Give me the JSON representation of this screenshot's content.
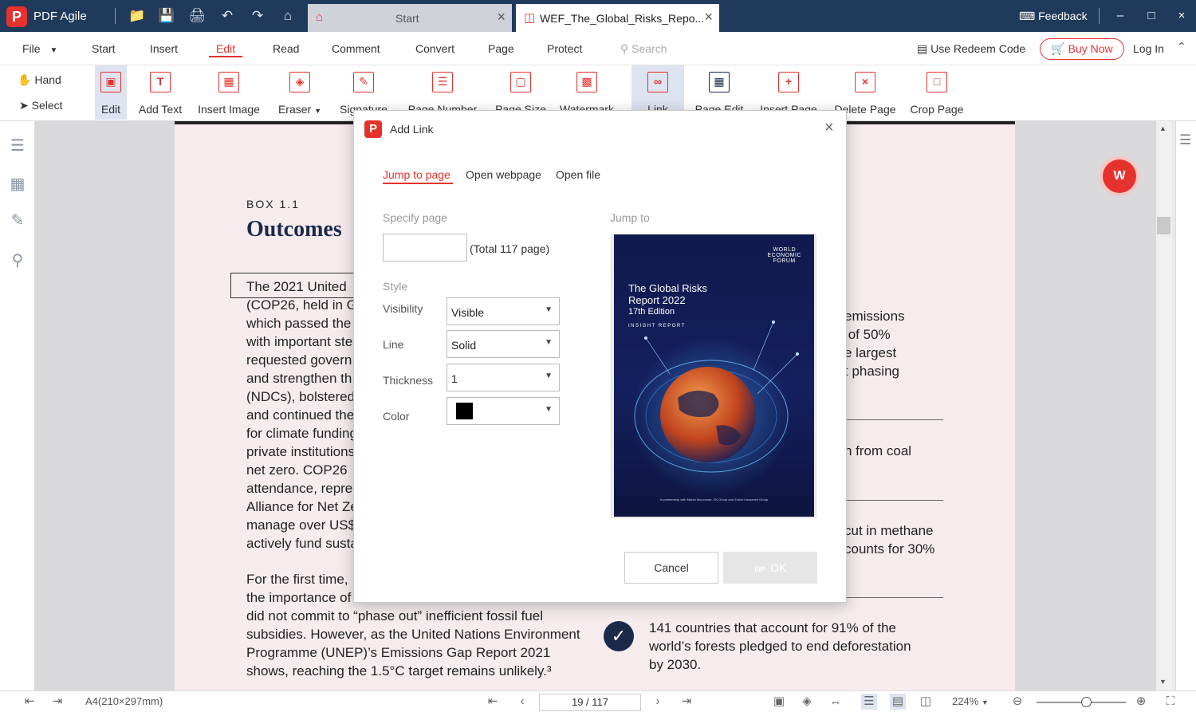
{
  "app": {
    "name": "PDF Agile",
    "tabs": [
      {
        "label": "Start"
      },
      {
        "label": "WEF_The_Global_Risks_Repo..."
      }
    ],
    "feedback": "Feedback"
  },
  "menu": {
    "items": [
      "File",
      "Start",
      "Insert",
      "Edit",
      "Read",
      "Comment",
      "Convert",
      "Page",
      "Protect"
    ],
    "active": "Edit",
    "search_placeholder": "Search",
    "redeem": "Use Redeem Code",
    "buy_now": "Buy Now",
    "login": "Log In"
  },
  "toolbar": {
    "hand": "Hand",
    "select": "Select",
    "tools": [
      {
        "label": "Edit",
        "icon": "edit-icon"
      },
      {
        "label": "Add Text",
        "icon": "add-text-icon"
      },
      {
        "label": "Insert Image",
        "icon": "insert-image-icon"
      },
      {
        "label": "Eraser",
        "icon": "eraser-icon"
      },
      {
        "label": "Signature",
        "icon": "signature-icon"
      },
      {
        "label": "Page Number",
        "icon": "page-number-icon"
      },
      {
        "label": "Page Size",
        "icon": "page-size-icon"
      },
      {
        "label": "Watermark",
        "icon": "watermark-icon"
      },
      {
        "label": "Link",
        "icon": "link-icon"
      },
      {
        "label": "Page Edit",
        "icon": "page-edit-icon"
      },
      {
        "label": "Insert Page",
        "icon": "insert-page-icon"
      },
      {
        "label": "Delete Page",
        "icon": "delete-page-icon"
      },
      {
        "label": "Crop Page",
        "icon": "crop-page-icon"
      }
    ]
  },
  "document": {
    "box_label": "BOX 1.1",
    "title": "Outcomes",
    "left_para1": "The 2021 United\n(COP26, held in G\nwhich passed the\nwith important ste\nrequested govern\nand strengthen th\n(NDCs), bolstered\nand continued the\nfor climate funding\nprivate institutions\nnet zero. COP26\nattendance, repre\nAlliance for Net Ze\nmanage over US$\nactively fund susta",
    "left_para2": "For the first time,\nthe importance of\ndid not commit to “phase out” inefficient fossil fuel\nsubsidies. However, as the United Nations Environment\nProgramme (UNEP)’s Emissions Gap Report 2021\nshows, reaching the 1.5°C target remains unlikely.³",
    "right_block1": "emissions\n of 50%\ne largest\nt phasing",
    "right_block2": "n from coal",
    "right_block3": "cut in methane\ncounts for 30%",
    "right_block4": "141 countries that account for 91% of the\nworld’s forests pledged to end deforestation\nby 2030."
  },
  "status": {
    "page_size": "A4(210×297mm)",
    "page_indicator": "19 / 117",
    "zoom": "224%"
  },
  "dialog": {
    "title": "Add Link",
    "tabs": [
      "Jump to page",
      "Open webpage",
      "Open file"
    ],
    "active_tab": "Jump to page",
    "specify_page": "Specify page",
    "page_value": "",
    "total": "(Total 117 page)",
    "style_label": "Style",
    "visibility_label": "Visibility",
    "visibility_value": "Visible",
    "line_label": "Line",
    "line_value": "Solid",
    "thickness_label": "Thickness",
    "thickness_value": "1",
    "color_label": "Color",
    "color_value": "#000000",
    "jump_to": "Jump to",
    "preview": {
      "org": "WORLD\nECONOMIC\nFORUM",
      "title": "The Global Risks\nReport 2022",
      "edition": "17th Edition",
      "subtitle": "INSIGHT REPORT",
      "partners": "In partnership with Marsh McLennan, SK Group and Zurich Insurance Group"
    },
    "cancel": "Cancel",
    "ok": "OK",
    "vip": "VIP"
  },
  "colors": {
    "accent": "#e5322d",
    "titlebar": "#203a5c",
    "navy": "#1b2a4a"
  }
}
